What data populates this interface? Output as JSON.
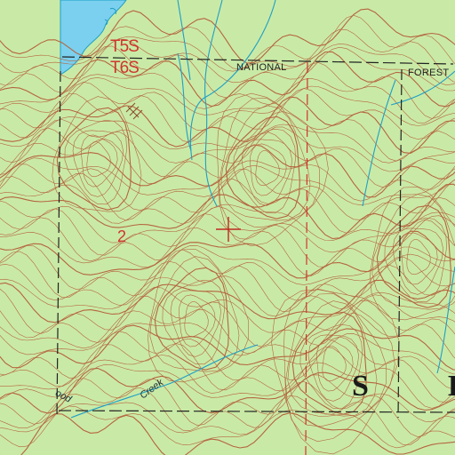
{
  "map": {
    "colors": {
      "land": "#c9eaa6",
      "water": "#7ad0ee",
      "contour": "#b5653f",
      "stream": "#1f9fc6",
      "survey_line": "#d0352d",
      "lettering": "#1a1a1a"
    },
    "marker": {
      "icon": "crosshair-icon"
    },
    "labels": {
      "township_north": "T5S",
      "township_south": "T6S",
      "section_number": "2",
      "national": "NATIONAL",
      "forest": "FOREST",
      "big_letters": "S I",
      "creek_fragment": "ood",
      "creek_name": "Creek"
    }
  }
}
